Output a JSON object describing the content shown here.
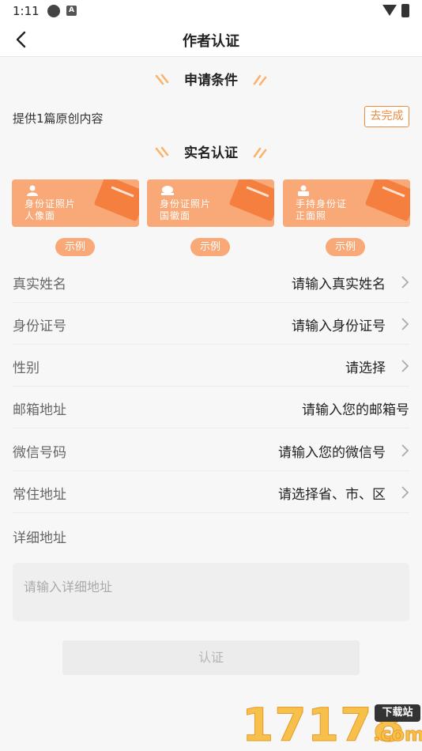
{
  "status": {
    "time": "1:11",
    "app_icon_letter": "A"
  },
  "nav": {
    "title": "作者认证"
  },
  "conditions": {
    "section_title": "申请条件",
    "item_text": "提供1篇原创内容",
    "action_label": "去完成"
  },
  "verification": {
    "section_title": "实名认证",
    "cards": [
      {
        "line1": "身份证照片",
        "line2": "人像面",
        "icon": "person-icon",
        "example_label": "示例"
      },
      {
        "line1": "身份证照片",
        "line2": "国徽面",
        "icon": "emblem-icon",
        "example_label": "示例"
      },
      {
        "line1": "手持身份证",
        "line2": "正面照",
        "icon": "hand-id-icon",
        "example_label": "示例"
      }
    ]
  },
  "form": {
    "rows": [
      {
        "label": "真实姓名",
        "value": "请输入真实姓名",
        "chevron": true
      },
      {
        "label": "身份证号",
        "value": "请输入身份证号",
        "chevron": true
      },
      {
        "label": "性别",
        "value": "请选择",
        "chevron": true
      },
      {
        "label": "邮箱地址",
        "value": "请输入您的邮箱号",
        "chevron": false
      },
      {
        "label": "微信号码",
        "value": "请输入您的微信号",
        "chevron": true
      },
      {
        "label": "常住地址",
        "value": "请选择省、市、区",
        "chevron": true
      }
    ],
    "detail_label": "详细地址",
    "detail_placeholder": "请输入详细地址"
  },
  "submit": {
    "label": "认证"
  },
  "watermark": {
    "number": "17178",
    "badge": "下载站",
    "suffix": ".com"
  },
  "colors": {
    "accent": "#f08a3c",
    "card": "#f9a877"
  }
}
